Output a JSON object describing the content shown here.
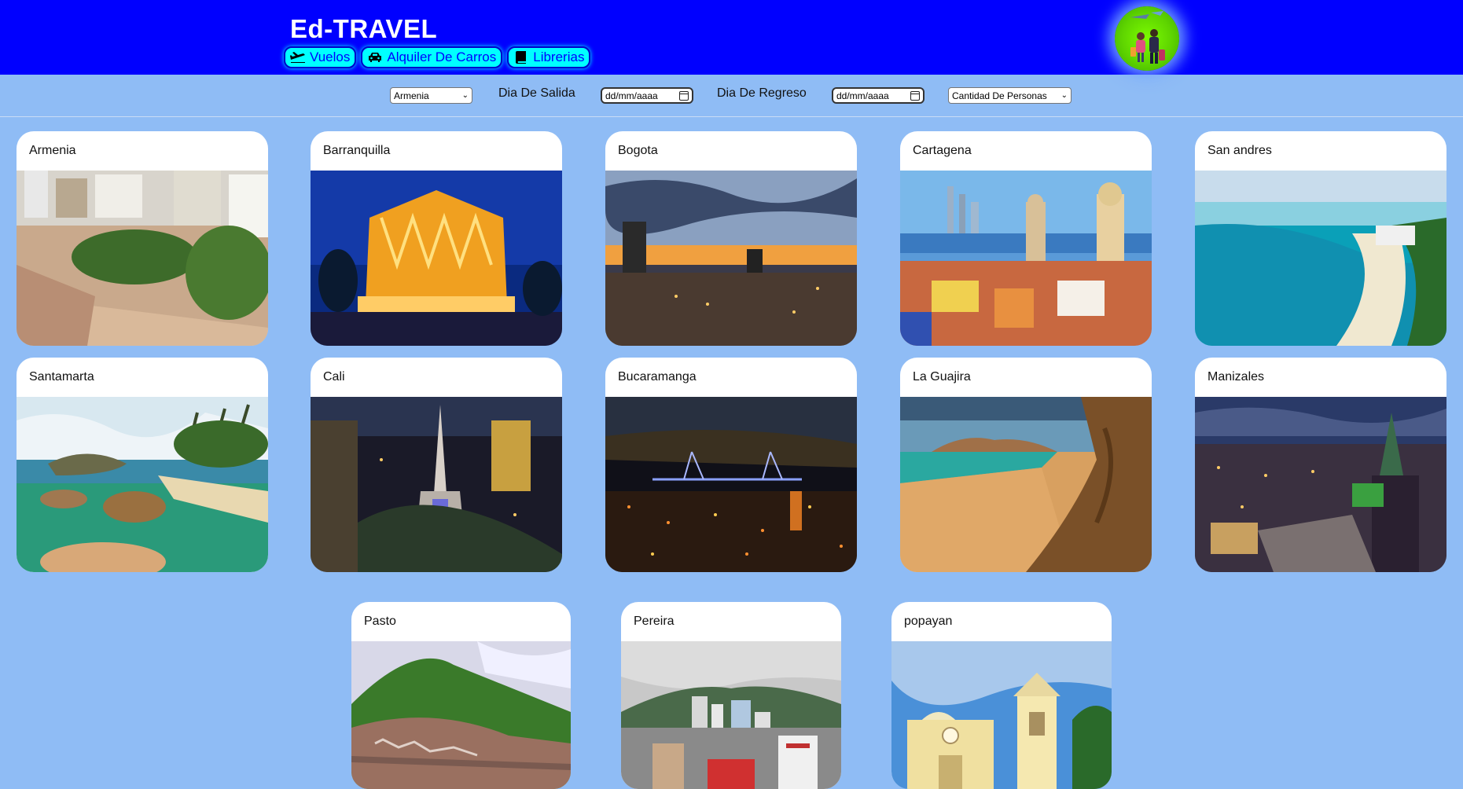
{
  "header": {
    "brand": "Ed-TRAVEL",
    "nav": [
      {
        "label": "Vuelos",
        "icon": "plane-icon"
      },
      {
        "label": "Alquiler De Carros",
        "icon": "car-icon"
      },
      {
        "label": "Librerias",
        "icon": "book-icon"
      }
    ],
    "logo_icon": "travelers-logo"
  },
  "filters": {
    "city_select": "Armenia",
    "departure_label": "Dia De Salida",
    "departure_placeholder": "dd/mm/aaaa",
    "return_label": "Dia De Regreso",
    "return_placeholder": "dd/mm/aaaa",
    "people_select": "Cantidad De Personas"
  },
  "cities": [
    {
      "name": "Armenia"
    },
    {
      "name": "Barranquilla"
    },
    {
      "name": "Bogota"
    },
    {
      "name": "Cartagena"
    },
    {
      "name": "San andres"
    },
    {
      "name": "Santamarta"
    },
    {
      "name": "Cali"
    },
    {
      "name": "Bucaramanga"
    },
    {
      "name": "La Guajira"
    },
    {
      "name": "Manizales"
    },
    {
      "name": "Pasto"
    },
    {
      "name": "Pereira"
    },
    {
      "name": "popayan"
    }
  ],
  "colors": {
    "header_bg": "#0000ff",
    "page_bg": "#8fbcf5",
    "nav_btn_bg": "#00ffff",
    "logo_bg": "#7cfc00"
  }
}
